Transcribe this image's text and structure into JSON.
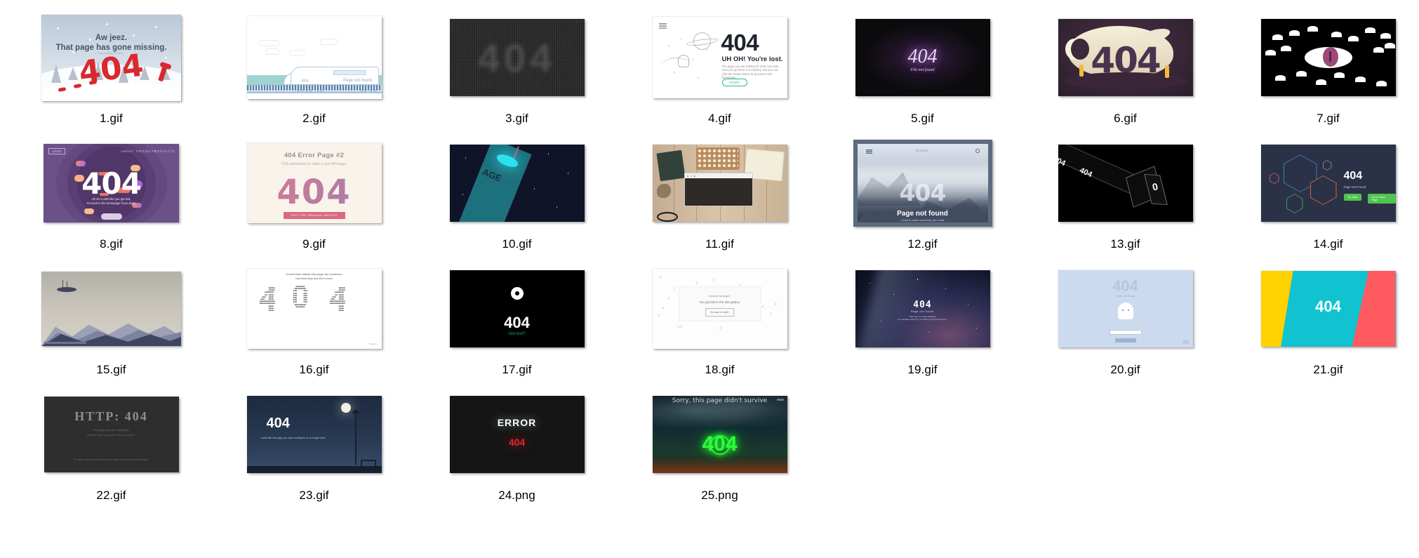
{
  "view": {
    "type": "file-explorer-thumbnail-grid",
    "columns": 7,
    "rows": 4,
    "item_count": 25
  },
  "items": [
    {
      "filename": "1.gif",
      "kind": "gif",
      "content": {
        "headline_line1": "Aw jeez.",
        "headline_line2": "That page has gone missing.",
        "big_number": "404",
        "tiny_note": "Not a whole lot here.",
        "theme": "snowy landscape",
        "colors": {
          "sky": "#b9c8d8",
          "snow": "#fbfcfd",
          "accent": "#d8292f",
          "text": "#44546a"
        }
      }
    },
    {
      "filename": "2.gif",
      "kind": "gif",
      "content": {
        "small_number": "404",
        "caption": "Page not found.",
        "theme": "train on track",
        "colors": {
          "bg": "#ffffff",
          "sea": "#9fd3d2",
          "line": "#5b7fa6"
        }
      }
    },
    {
      "filename": "3.gif",
      "kind": "gif",
      "content": {
        "big_number": "404",
        "theme": "tv static noise",
        "colors": {
          "bg": "#1a1a1a",
          "text": "rgba(255,255,255,.16)"
        }
      }
    },
    {
      "filename": "4.gif",
      "kind": "gif",
      "content": {
        "big_number": "404",
        "subhead": "UH OH! You're lost.",
        "body": "The page you are looking for does not exist. How you got here is a mystery. But you can click the button below to go back to the homepage.",
        "button": "HOME",
        "theme": "astronaut line art",
        "colors": {
          "bg": "#ffffff",
          "text": "#1f2430",
          "accent": "#2bc07a"
        }
      }
    },
    {
      "filename": "5.gif",
      "kind": "gif",
      "content": {
        "big_number": "404",
        "caption": "File not found",
        "theme": "purple glow serif",
        "colors": {
          "bg": "#0b0b0d",
          "glow": "#b07cd8"
        }
      }
    },
    {
      "filename": "6.gif",
      "kind": "gif",
      "content": {
        "big_number": "404",
        "theme": "flat illustration with people and moon",
        "colors": {
          "bg": "#2b1f2b",
          "cream": "#f5eeda",
          "digits": "#4b3350",
          "figure": "#f0b93f"
        }
      }
    },
    {
      "filename": "7.gif",
      "kind": "gif",
      "content": {
        "theme": "big white eye with purple iris on black, surrounded by small eyes",
        "colors": {
          "bg": "#000000",
          "eye": "#ffffff",
          "iris": "#9c4a77"
        }
      }
    },
    {
      "filename": "8.gif",
      "kind": "gif",
      "content": {
        "logo": "LOGO",
        "nav": [
          "ABOUT",
          "PROJECTS",
          "CONTACTS"
        ],
        "big_number": "404",
        "caption_line1": "Uh oh! Looks like you got lost.",
        "caption_line2": "Go back to the homepage if you dare!",
        "theme": "purple circles with floating pills",
        "colors": {
          "bg": "#6b5188",
          "ring": "#513669",
          "text": "#ffffff"
        }
      }
    },
    {
      "filename": "9.gif",
      "kind": "gif",
      "content": {
        "title": "404 Error Page #2",
        "subtitle": "CSS animations to make a cool 404 page.",
        "big_number": "404",
        "button": "VISIT THE ORIGINAL ARTICLE",
        "theme": "cream background gradient digits",
        "colors": {
          "bg": "#faf3ec",
          "grad_a": "#e0798f",
          "grad_b": "#9a7fae",
          "button": "#d9697f"
        }
      }
    },
    {
      "filename": "10.gif",
      "kind": "gif",
      "content": {
        "visible_text": "AGE",
        "theme": "tilted card flying like a rocket in space",
        "colors": {
          "bg": "#101428",
          "card": "#1f7b86",
          "flame": "#2de2f0"
        }
      }
    },
    {
      "filename": "11.gif",
      "kind": "gif",
      "content": {
        "theme": "desk photo with typewriter, notebook, glasses and a browser window",
        "colors": {
          "wood": "#d9c5ab",
          "window": "#2e2a27"
        }
      }
    },
    {
      "filename": "12.gif",
      "kind": "gif",
      "content": {
        "brand": "DAILY",
        "big_number": "404",
        "headline": "Page not found",
        "subtitle": "I tried to catch some fog, but i mist",
        "theme": "foggy pine forest in a browser frame",
        "colors": {
          "frame": "#5d6b80",
          "sky": "#dfe5ee",
          "forest": "#2b3242"
        }
      }
    },
    {
      "filename": "13.gif",
      "kind": "gif",
      "content": {
        "strip_text": "404",
        "cube_text": "0",
        "theme": "3d black cube and ribbon",
        "colors": {
          "bg": "#000000",
          "edge": "#6a6a6a"
        }
      }
    },
    {
      "filename": "14.gif",
      "kind": "gif",
      "content": {
        "big_number": "404",
        "subtitle": "Page Not Found",
        "buttons": [
          "Go Back",
          "Go to Home Page"
        ],
        "theme": "outlined hexagons on navy",
        "colors": {
          "bg": "#2b3147",
          "button": "#4fc44f",
          "hex_blue": "#3c7fb1",
          "hex_orange": "#c4693f",
          "hex_green": "#3f9a6a",
          "hex_pink": "#c2566f"
        }
      }
    },
    {
      "filename": "15.gif",
      "kind": "gif",
      "content": {
        "theme": "layered flat mountains with floating island",
        "colors": {
          "sky": "#cbc7bd",
          "far": "#8a90a8",
          "near": "#3a4058"
        }
      }
    },
    {
      "filename": "16.gif",
      "kind": "gif",
      "content": {
        "headline": "Government defined this page 'the revolution'",
        "sub": "Use Arrow keys and 404 to move",
        "big_number": "404",
        "theme": "404 built from keyboard keys",
        "version": "Version 1",
        "colors": {
          "bg": "#ffffff",
          "keys": "#2b2b2b",
          "accent": "#e03b3b"
        }
      }
    },
    {
      "filename": "17.gif",
      "kind": "gif",
      "content": {
        "big_number": "404",
        "caption": "Got lost?",
        "theme": "white donut on black",
        "colors": {
          "bg": "#000000",
          "text": "#ffffff",
          "link": "#17a98e"
        }
      }
    },
    {
      "filename": "18.gif",
      "kind": "gif",
      "content": {
        "line1": "Dearest stranger,",
        "line2": "You got lost in the 404 galaxy.",
        "button": "Go back to earth.",
        "theme": "scattered digits on white",
        "colors": {
          "bg": "#fdfdfd",
          "digits": "#c8c8c8",
          "text": "#6d6d6d"
        }
      }
    },
    {
      "filename": "19.gif",
      "kind": "gif",
      "content": {
        "big_number": "404",
        "headline": "Page not found",
        "sub_line1": "That may not mean anything.",
        "sub_line2": "I'm probably missing or something that has blown up.",
        "theme": "milky way night sky",
        "colors": {
          "bg": "#14182e",
          "glow": "#6b4b6e"
        }
      }
    },
    {
      "filename": "20.gif",
      "kind": "gif",
      "content": {
        "big_number": "404",
        "caption": "Page not found",
        "theme": "cute ghost with search box",
        "colors": {
          "bg": "#ccdaef",
          "ghost": "#ffffff",
          "text": "#9aaac4"
        }
      }
    },
    {
      "filename": "21.gif",
      "kind": "gif",
      "content": {
        "big_number": "404",
        "theme": "flat color blocks yellow cyan red",
        "colors": {
          "yellow": "#ffd200",
          "cyan": "#11c3d1",
          "red": "#ff5a5f",
          "text": "#ffffff"
        }
      }
    },
    {
      "filename": "22.gif",
      "kind": "gif",
      "content": {
        "headline": "HTTP: 404",
        "sub_line1": "The page you are looking for",
        "sub_line2": "doesn't exist or another error occurred.",
        "footer": "Go back, or head over to the home page to choose a new direction.",
        "theme": "dark grey serif type",
        "colors": {
          "bg": "#2e2e2e",
          "text": "#8e8e8e"
        }
      }
    },
    {
      "filename": "23.gif",
      "kind": "gif",
      "content": {
        "big_number": "404",
        "body": "Looks like the page you were looking for is no longer here.",
        "theme": "night park scene with lamp post, moon and bench",
        "colors": {
          "sky": "#1d2a3e",
          "ground": "#16202e",
          "moon": "#f3f1e4"
        }
      }
    },
    {
      "filename": "24.png",
      "kind": "png",
      "content": {
        "headline": "ERROR",
        "big_number": "404",
        "theme": "glowing neon text on near-black",
        "colors": {
          "bg": "#151515",
          "error": "#ffffff",
          "number": "#e8242b"
        }
      }
    },
    {
      "filename": "25.png",
      "kind": "png",
      "content": {
        "headline": "Sorry, this page didn't survive",
        "big_number": "404",
        "theme": "green neon digits over burning night landscape",
        "colors": {
          "neon": "#2bff3a",
          "sky": "#122c33",
          "fire": "#dc5a1e"
        }
      }
    }
  ]
}
